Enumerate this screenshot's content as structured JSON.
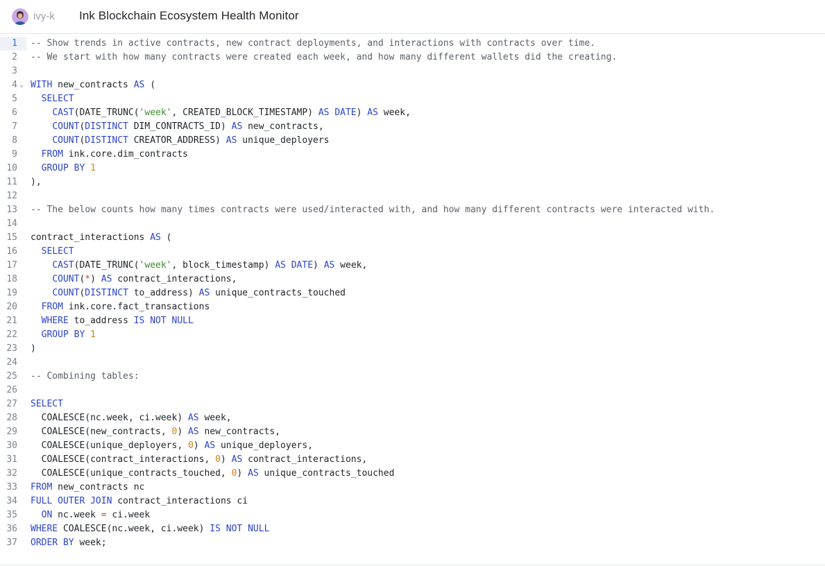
{
  "header": {
    "username": "ivy-k",
    "title": "Ink Blockchain Ecosystem Health Monitor",
    "avatar_icon": "user-avatar-icon"
  },
  "editor": {
    "active_line": 1,
    "fold_line": 4,
    "lines": [
      [
        [
          "cmt",
          "-- Show trends in active contracts, new contract deployments, and interactions with contracts over time."
        ]
      ],
      [
        [
          "cmt",
          "-- We start with how many contracts were created each week, and how many different wallets did the creating."
        ]
      ],
      [],
      [
        [
          "kw",
          "WITH"
        ],
        [
          "t",
          " new_contracts "
        ],
        [
          "kw",
          "AS"
        ],
        [
          "t",
          " ("
        ]
      ],
      [
        [
          "t",
          "  "
        ],
        [
          "kw",
          "SELECT"
        ]
      ],
      [
        [
          "t",
          "    "
        ],
        [
          "fn",
          "CAST"
        ],
        [
          "t",
          "(DATE_TRUNC("
        ],
        [
          "str",
          "'week'"
        ],
        [
          "t",
          ", CREATED_BLOCK_TIMESTAMP) "
        ],
        [
          "kw",
          "AS"
        ],
        [
          "t",
          " "
        ],
        [
          "kw",
          "DATE"
        ],
        [
          "t",
          ") "
        ],
        [
          "kw",
          "AS"
        ],
        [
          "t",
          " week,"
        ]
      ],
      [
        [
          "t",
          "    "
        ],
        [
          "fn",
          "COUNT"
        ],
        [
          "t",
          "("
        ],
        [
          "kw",
          "DISTINCT"
        ],
        [
          "t",
          " DIM_CONTRACTS_ID) "
        ],
        [
          "kw",
          "AS"
        ],
        [
          "t",
          " new_contracts,"
        ]
      ],
      [
        [
          "t",
          "    "
        ],
        [
          "fn",
          "COUNT"
        ],
        [
          "t",
          "("
        ],
        [
          "kw",
          "DISTINCT"
        ],
        [
          "t",
          " CREATOR_ADDRESS) "
        ],
        [
          "kw",
          "AS"
        ],
        [
          "t",
          " unique_deployers"
        ]
      ],
      [
        [
          "t",
          "  "
        ],
        [
          "kw",
          "FROM"
        ],
        [
          "t",
          " ink.core.dim_contracts"
        ]
      ],
      [
        [
          "t",
          "  "
        ],
        [
          "kw",
          "GROUP BY"
        ],
        [
          "t",
          " "
        ],
        [
          "num",
          "1"
        ]
      ],
      [
        [
          "t",
          "),"
        ]
      ],
      [],
      [
        [
          "cmt",
          "-- The below counts how many times contracts were used/interacted with, and how many different contracts were interacted with."
        ]
      ],
      [],
      [
        [
          "t",
          "contract_interactions "
        ],
        [
          "kw",
          "AS"
        ],
        [
          "t",
          " ("
        ]
      ],
      [
        [
          "t",
          "  "
        ],
        [
          "kw",
          "SELECT"
        ]
      ],
      [
        [
          "t",
          "    "
        ],
        [
          "fn",
          "CAST"
        ],
        [
          "t",
          "(DATE_TRUNC("
        ],
        [
          "str",
          "'week'"
        ],
        [
          "t",
          ", block_timestamp) "
        ],
        [
          "kw",
          "AS"
        ],
        [
          "t",
          " "
        ],
        [
          "kw",
          "DATE"
        ],
        [
          "t",
          ") "
        ],
        [
          "kw",
          "AS"
        ],
        [
          "t",
          " week,"
        ]
      ],
      [
        [
          "t",
          "    "
        ],
        [
          "fn",
          "COUNT"
        ],
        [
          "t",
          "("
        ],
        [
          "op",
          "*"
        ],
        [
          "t",
          ") "
        ],
        [
          "kw",
          "AS"
        ],
        [
          "t",
          " contract_interactions,"
        ]
      ],
      [
        [
          "t",
          "    "
        ],
        [
          "fn",
          "COUNT"
        ],
        [
          "t",
          "("
        ],
        [
          "kw",
          "DISTINCT"
        ],
        [
          "t",
          " to_address) "
        ],
        [
          "kw",
          "AS"
        ],
        [
          "t",
          " unique_contracts_touched"
        ]
      ],
      [
        [
          "t",
          "  "
        ],
        [
          "kw",
          "FROM"
        ],
        [
          "t",
          " ink.core.fact_transactions"
        ]
      ],
      [
        [
          "t",
          "  "
        ],
        [
          "kw",
          "WHERE"
        ],
        [
          "t",
          " to_address "
        ],
        [
          "kw",
          "IS NOT NULL"
        ]
      ],
      [
        [
          "t",
          "  "
        ],
        [
          "kw",
          "GROUP BY"
        ],
        [
          "t",
          " "
        ],
        [
          "num",
          "1"
        ]
      ],
      [
        [
          "t",
          ")"
        ]
      ],
      [],
      [
        [
          "cmt",
          "-- Combining tables:"
        ]
      ],
      [],
      [
        [
          "kw",
          "SELECT"
        ]
      ],
      [
        [
          "t",
          "  COALESCE(nc.week, ci.week) "
        ],
        [
          "kw",
          "AS"
        ],
        [
          "t",
          " week,"
        ]
      ],
      [
        [
          "t",
          "  COALESCE(new_contracts, "
        ],
        [
          "num",
          "0"
        ],
        [
          "t",
          ") "
        ],
        [
          "kw",
          "AS"
        ],
        [
          "t",
          " new_contracts,"
        ]
      ],
      [
        [
          "t",
          "  COALESCE(unique_deployers, "
        ],
        [
          "num",
          "0"
        ],
        [
          "t",
          ") "
        ],
        [
          "kw",
          "AS"
        ],
        [
          "t",
          " unique_deployers,"
        ]
      ],
      [
        [
          "t",
          "  COALESCE(contract_interactions, "
        ],
        [
          "num",
          "0"
        ],
        [
          "t",
          ") "
        ],
        [
          "kw",
          "AS"
        ],
        [
          "t",
          " contract_interactions,"
        ]
      ],
      [
        [
          "t",
          "  COALESCE(unique_contracts_touched, "
        ],
        [
          "num",
          "0"
        ],
        [
          "t",
          ") "
        ],
        [
          "kw",
          "AS"
        ],
        [
          "t",
          " unique_contracts_touched"
        ]
      ],
      [
        [
          "kw",
          "FROM"
        ],
        [
          "t",
          " new_contracts nc"
        ]
      ],
      [
        [
          "kw",
          "FULL OUTER JOIN"
        ],
        [
          "t",
          " contract_interactions ci"
        ]
      ],
      [
        [
          "t",
          "  "
        ],
        [
          "kw",
          "ON"
        ],
        [
          "t",
          " nc.week "
        ],
        [
          "op",
          "="
        ],
        [
          "t",
          " ci.week"
        ]
      ],
      [
        [
          "kw",
          "WHERE"
        ],
        [
          "t",
          " COALESCE(nc.week, ci.week) "
        ],
        [
          "kw",
          "IS NOT NULL"
        ]
      ],
      [
        [
          "kw",
          "ORDER BY"
        ],
        [
          "t",
          " week;"
        ]
      ]
    ]
  }
}
